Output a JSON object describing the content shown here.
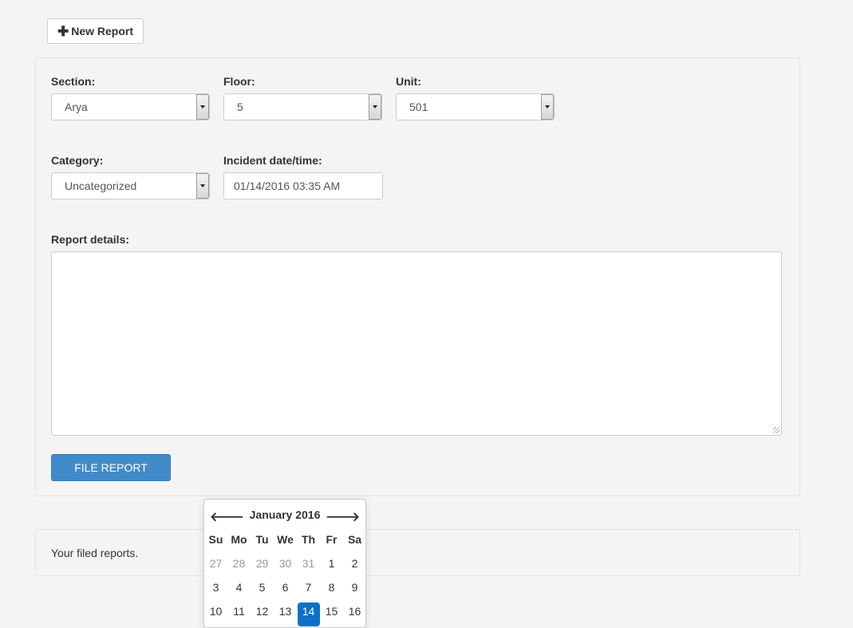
{
  "toolbar": {
    "new_report_label": "New Report"
  },
  "form": {
    "section": {
      "label": "Section:",
      "value": "Arya"
    },
    "floor": {
      "label": "Floor:",
      "value": "5"
    },
    "unit": {
      "label": "Unit:",
      "value": "501"
    },
    "category": {
      "label": "Category:",
      "value": "Uncategorized"
    },
    "incident": {
      "label": "Incident date/time:",
      "value": "01/14/2016 03:35 AM"
    },
    "details": {
      "label": "Report details:",
      "value": ""
    },
    "submit_label": "FILE REPORT"
  },
  "reports": {
    "text": "Your filed reports."
  },
  "datepicker": {
    "title": "January 2016",
    "prev_icon": "arrow-left-icon",
    "next_icon": "arrow-right-icon",
    "dow": [
      "Su",
      "Mo",
      "Tu",
      "We",
      "Th",
      "Fr",
      "Sa"
    ],
    "week1": [
      "27",
      "28",
      "29",
      "30",
      "31",
      "1",
      "2"
    ],
    "week2": [
      "3",
      "4",
      "5",
      "6",
      "7",
      "8",
      "9"
    ],
    "week3": [
      "10",
      "11",
      "12",
      "13",
      "14",
      "15",
      "16"
    ],
    "selected_day": "14",
    "selected_color": "#0b72c6"
  },
  "colors": {
    "primary_button": "#428bca"
  }
}
